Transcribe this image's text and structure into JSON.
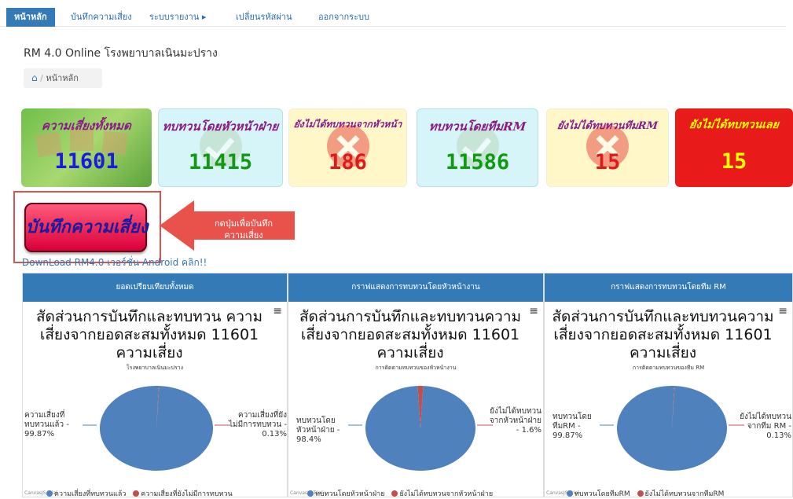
{
  "nav": {
    "items": [
      {
        "label": "หน้าหลัก",
        "active": true
      },
      {
        "label": "บันทึกความเสี่ยง"
      },
      {
        "label": "ระบบรายงาน ▸"
      },
      {
        "label": "เปลี่ยนรหัสผ่าน"
      },
      {
        "label": "ออกจากระบบ"
      }
    ]
  },
  "page": {
    "title": "RM 4.0 Online โรงพยาบาลเนินมะปราง"
  },
  "breadcrumb": {
    "label": "หน้าหลัก"
  },
  "stats": [
    {
      "label": "ความเสี่ยงทั้งหมด",
      "value": "11601",
      "label_color": "#8a1a8a",
      "value_color": "#1a1ae0"
    },
    {
      "label": "ทบทวนโดยหัวหน้าฝ่าย",
      "value": "11415",
      "label_color": "#8a1a8a",
      "value_color": "#119911"
    },
    {
      "label": "ยังไม่ได้ทบทวนจากหัวหน้า",
      "value": "186",
      "label_color": "#8a1a8a",
      "value_color": "#e01a1a"
    },
    {
      "label": "ทบทวนโดยทีมRM",
      "value": "11586",
      "label_color": "#8a1a8a",
      "value_color": "#119911"
    },
    {
      "label": "ยังไม่ได้ทบทวนทีมRM",
      "value": "15",
      "label_color": "#8a1a8a",
      "value_color": "#e01a1a"
    },
    {
      "label": "ยังไม่ได้ทบทวนเลย",
      "value": "15",
      "label_color": "#ffff00",
      "value_color": "#ffff00"
    }
  ],
  "record_button": {
    "label": "บันทึกความเสี่ยง"
  },
  "hint": {
    "line1": "กดปุ่มเพื่อบันทึก",
    "line2": "ความเสี่ยง"
  },
  "android_link": "DownLoad RM4.0 เวอร์ชั่น Android คลิก!!",
  "colors": {
    "primary": "#337ab7",
    "pie_main": "#4f81bd",
    "pie_minor": "#c0504d"
  },
  "panels": [
    {
      "header": "ยอดเปรียบเทียบทั้งหมด",
      "title": "สัดส่วนการบันทึกและทบทวน ความเสี่ยงจากยอดสะสมทั้งหมด 11601 ความเสี่ยง",
      "subtitle": "โรงพยาบาลเนินมะปราง",
      "left_label": "ความเสี่ยงที่ทบทวนแล้ว - 99.87%",
      "right_label": "ความเสี่ยงที่ยังไม่มีการทบทวน - 0.13%",
      "legend": [
        "ความเสี่ยงที่ทบทวนแล้ว",
        "ความเสี่ยงที่ยังไม่มีการทบทวน"
      ],
      "trial": "CanvasJS Trial"
    },
    {
      "header": "กราฟแสดงการทบทวนโดยหัวหน้างาน",
      "title": "สัดส่วนการบันทึกและทบทวนความเสี่ยงจากยอดสะสมทั้งหมด 11601 ความเสี่ยง",
      "subtitle": "การติดตามทบทวนของหัวหน้างาน",
      "left_label": "ทบทวนโดยหัวหน้าฝ่าย - 98.4%",
      "right_label": "ยังไม่ได้ทบทวนจากหัวหน้าฝ่าย - 1.6%",
      "legend": [
        "ทบทวนโดยหัวหน้าฝ่าย",
        "ยังไม่ได้ทบทวนจากหัวหน้าฝ่าย"
      ],
      "trial": "CanvasJS Trial"
    },
    {
      "header": "กราฟแสดงการทบทวนโดยทีม RM",
      "title": "สัดส่วนการบันทึกและทบทวนความเสี่ยงจากยอดสะสมทั้งหมด 11601 ความเสี่ยง",
      "subtitle": "การติดตามทบทวนของทีม RM",
      "left_label": "ทบทวนโดยทีมRM - 99.87%",
      "right_label": "ยังไม่ได้ทบทวนจากทีม RM - 0.13%",
      "legend": [
        "ทบทวนโดยทีมRM",
        "ยังไม่ได้ทบทวนจากทีมRM"
      ],
      "trial": "CanvasJS Trial"
    }
  ],
  "chart_data": [
    {
      "type": "pie",
      "title": "สัดส่วนการบันทึกและทบทวนความเสี่ยงจากยอดสะสมทั้งหมด 11601 ความเสี่ยง",
      "categories": [
        "ความเสี่ยงที่ทบทวนแล้ว",
        "ความเสี่ยงที่ยังไม่มีการทบทวน"
      ],
      "values": [
        99.87,
        0.13
      ]
    },
    {
      "type": "pie",
      "title": "สัดส่วนการบันทึกและทบทวนความเสี่ยงจากยอดสะสมทั้งหมด 11601 ความเสี่ยง",
      "categories": [
        "ทบทวนโดยหัวหน้าฝ่าย",
        "ยังไม่ได้ทบทวนจากหัวหน้าฝ่าย"
      ],
      "values": [
        98.4,
        1.6
      ]
    },
    {
      "type": "pie",
      "title": "สัดส่วนการบันทึกและทบทวนความเสี่ยงจากยอดสะสมทั้งหมด 11601 ความเสี่ยง",
      "categories": [
        "ทบทวนโดยทีมRM",
        "ยังไม่ได้ทบทวนจากทีมRM"
      ],
      "values": [
        99.87,
        0.13
      ]
    }
  ]
}
